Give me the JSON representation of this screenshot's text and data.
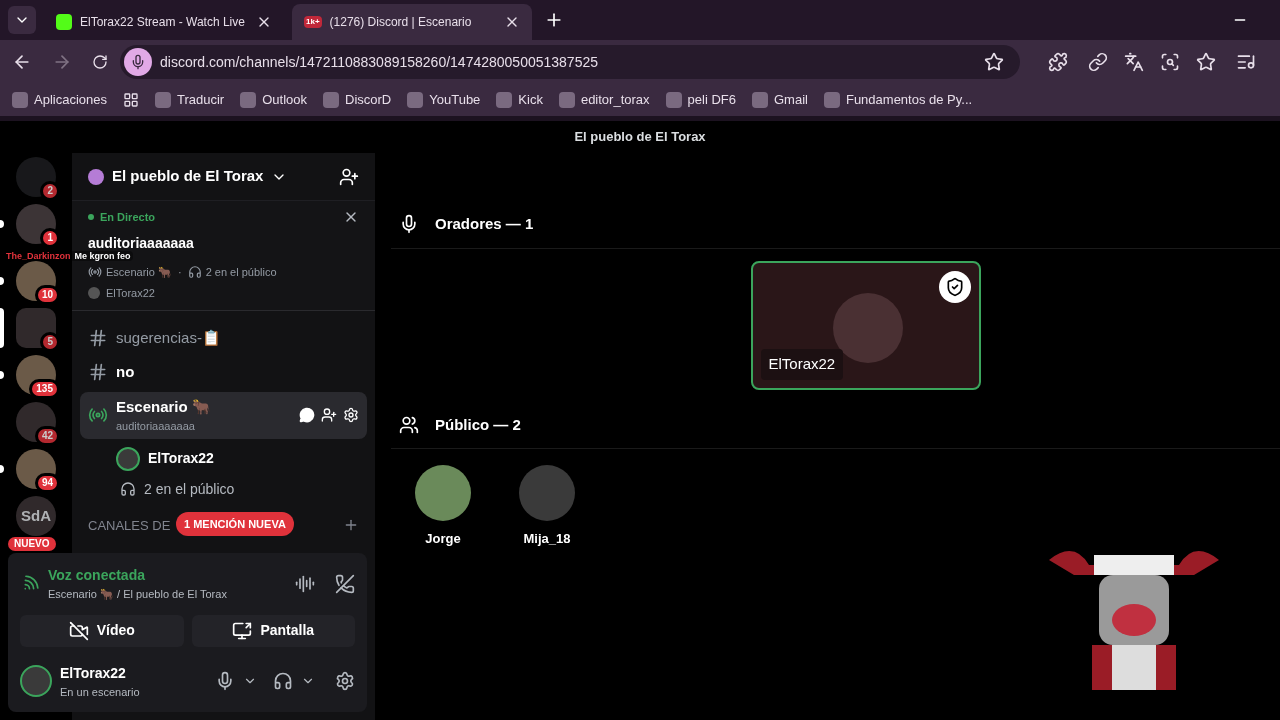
{
  "browser": {
    "tabs": [
      {
        "title": "ElTorax22 Stream - Watch Live",
        "selected": false
      },
      {
        "title": "(1276) Discord | Escenario",
        "badge": "1k+",
        "selected": true
      }
    ],
    "url": "discord.com/channels/1472110883089158260/1474280050051387525",
    "bookmarks": [
      "Aplicaciones",
      "Traducir",
      "Outlook",
      "DiscorD",
      "YouTube",
      "Kick",
      "editor_torax",
      "peli DF6",
      "Gmail",
      "Fundamentos de Py..."
    ]
  },
  "title": "El pueblo de El Torax",
  "servers": [
    {
      "badge": "2",
      "unread": false,
      "selected": false
    },
    {
      "badge": "1",
      "unread": true,
      "selected": false
    },
    {
      "badge": "10",
      "unread": true,
      "selected": false
    },
    {
      "badge": "5",
      "unread": false,
      "selected": true
    },
    {
      "badge": "135",
      "unread": true,
      "selected": false
    },
    {
      "badge": "42",
      "unread": false,
      "selected": false
    },
    {
      "badge": "94",
      "unread": true,
      "selected": false
    },
    {
      "label": "SdA",
      "unread": false,
      "selected": false
    }
  ],
  "new_pill": "NUEVO",
  "overlay_chat": {
    "user": "The_Darkinzon",
    "message": "Me kgron feo"
  },
  "server_name": "El pueblo de El Torax",
  "live_card": {
    "status": "En Directo",
    "title": "auditoriaaaaaaa",
    "stage": "Escenario 🐂",
    "separator": "·",
    "audience": "2 en el público",
    "host": "ElTorax22"
  },
  "channels": [
    {
      "kind": "text",
      "name": "sugerencias-📋",
      "selected": false
    },
    {
      "kind": "text",
      "name": "no",
      "selected": false
    },
    {
      "kind": "stage",
      "name": "Escenario 🐂",
      "subtitle": "auditoriaaaaaaa",
      "selected": true
    }
  ],
  "stage_speaker": "ElTorax22",
  "stage_audience": "2 en el público",
  "category": "CANALES DE",
  "mention_pill": "1 MENCIÓN NUEVA",
  "voice": {
    "status": "Voz conectada",
    "location": "Escenario 🐂 / El pueblo de El Torax",
    "buttons": [
      "Vídeo",
      "Pantalla"
    ]
  },
  "user": {
    "name": "ElTorax22",
    "status": "En un escenario"
  },
  "speakers": {
    "heading": "Oradores — 1",
    "members": [
      {
        "name": "ElTorax22",
        "moderator": true
      }
    ]
  },
  "audience": {
    "heading": "Público — 2",
    "members": [
      "Jorge",
      "Mija_18"
    ]
  }
}
